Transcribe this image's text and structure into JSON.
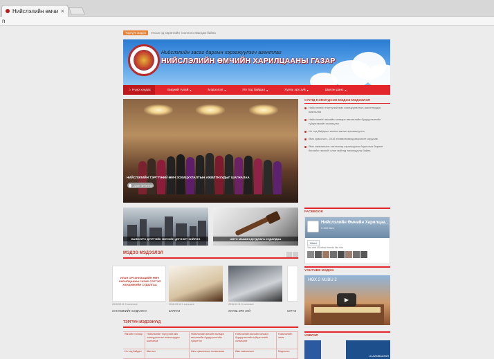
{
  "browser": {
    "tab_title": "Нийслэлийн өмчий",
    "tab_close": "×",
    "address": "n"
  },
  "site": {
    "ticker_badge": "Тэргүүн мэдээ",
    "ticker_text": "Улсын эд хөрөнгийн тооллого явагдаж байна",
    "header_subtitle": "Нийслэлийн засаг даргын хэрэгжүүлэгч агентлаг",
    "header_title": "НИЙСЛЭЛИЙН ӨМЧИЙН ХАРИЛЦААНЫ ГАЗАР",
    "nav": [
      {
        "label": "Нүүр хуудас",
        "caret": ""
      },
      {
        "label": "Бидний тухай",
        "caret": "▾"
      },
      {
        "label": "Мэдээлэл",
        "caret": "▾"
      },
      {
        "label": "Ил тод байдал",
        "caret": "▾"
      },
      {
        "label": "Хууль эрх зүй",
        "caret": "▾"
      },
      {
        "label": "Шилэн данс",
        "caret": "▾"
      }
    ],
    "slider": {
      "caption": "НИЙСЛЭЛИЙН ТЭРГҮҮНИЙ ӨМЧ ЗОХИЦУУЛАЛТЫН АЖИЛТНУУДЫГ ШАГНАЛАА",
      "button": "ДЭЛГЭРЭНГҮЙ"
    },
    "side_news": {
      "title": "СҮҮЛД НЭМЭГДСЭН МЭДЭЭ МЭДЭЭЛЭЛ",
      "items": [
        "Нийслэлийн тэргүүний өмч зохицуулалтын ажилтнуудыг шагналаа",
        "Нийслэлийн өмчийн талаарх өмчлөлийн бүрдүүлэлтийн гүйцэтгэлийг хэлэлцлээ",
        "Ил тод байдлыг хангах ажлыг эрчимжүүлнэ",
        "Өмч хувьчлал - 2016 төлөвлөгөөнд өөрчлөлт оруулав",
        "Өмч хамгаалалт чиглэлээр хэрэгжүүлэх бодлогын баримт бичгийн төслийг олон нийтэд танилцуулж байна"
      ]
    },
    "tiles": [
      {
        "label": "БАЯНЗҮРХ ДҮҮРГИЙН ӨМЧИЙН ДҮГНЭЛТ ХИЙЛЭЭ"
      },
      {
        "label": "АВТО МАШИН ДУУДЛАГА ХУДАЛДАА"
      }
    ],
    "facebook": {
      "section_title": "FACEBOOK",
      "page_name": "Нийслэлийн Өмчийн Харилцаа...",
      "likes": "5 458 likes",
      "like_button": "Liked",
      "friends": "You and 45 other friends like this"
    },
    "youtube": {
      "section_title": "YOUTUBE МЭДЭЭ",
      "video_title": "НӨХ 2 NUBU 2",
      "play_icon": "▶"
    },
    "media": {
      "section_title": "ХЭВЛЭЛ",
      "right_label": "ULAANBAATAR"
    },
    "news": {
      "title": "МЭДЭЭ МЭДЭЭЛЭЛ",
      "cards": [
        {
          "image_text": "ИЛАН ОРГАНИЗАЦИЙН ӨМЧ ХАРИЛЦААНЫ ГАЗАР СЭТГЭЛ ХАНАМЖИЙН СУДАЛГАА",
          "meta": "2016.03.11    0 comment",
          "title": "ХАНАМЖИЙН СУДАЛГАА"
        },
        {
          "meta": "2016.03.11    0 comment",
          "title": "ЗАРЛАЛ"
        },
        {
          "meta": "2016.03.11    0 comment",
          "title": "ХУУЛЬ ЭРХ ЗҮЙ"
        },
        {
          "meta": "",
          "title": "СУГГЭ"
        }
      ]
    },
    "bottom": {
      "title": "ТЭРГҮҮН МЭДЭЭНҮҮД",
      "cells": [
        "Өмчийн талаар",
        "Нийслэлийн тэргүүний өмч зохицуулалтын ажилтнуудыг шагналаа",
        "Нийслэлийн өмчийн талаарх өмчлөлийн бүрдүүлэлтийн гүйцэтгэл",
        "Нийслэлийн өмчийн талаарх бүрдүүлэлтийн гүйцэтгэлийг хэлэлцлээ",
        "Нийслэлийн засаг",
        "Ил тод байдал",
        "Шагнал",
        "Өмч хувьчлалын төлөвлөгөө",
        "Өмч хамгаалалт",
        "Мэдээлэл"
      ]
    }
  }
}
